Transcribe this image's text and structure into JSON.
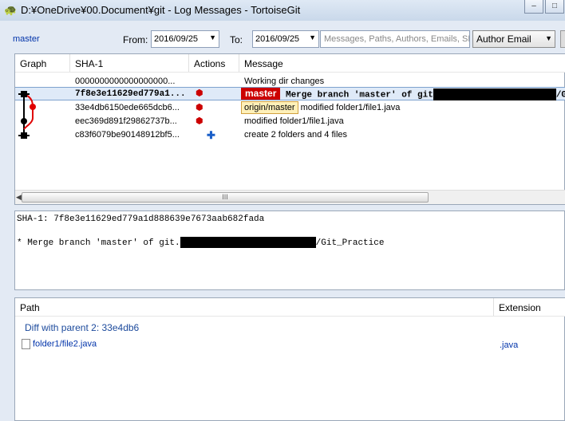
{
  "window": {
    "title": "D:¥OneDrive¥00.Document¥git - Log Messages - TortoiseGit",
    "minimize": "–",
    "maximize": "□"
  },
  "filters": {
    "branch": "master",
    "from_label": "From:",
    "from_date": "2016/09/25",
    "to_label": "To:",
    "to_date": "2016/09/25",
    "search_placeholder": "Messages, Paths, Authors, Emails, SHA",
    "filter_by": "Author Email"
  },
  "log_table": {
    "columns": [
      "Graph",
      "SHA-1",
      "Actions",
      "Message"
    ],
    "rows": [
      {
        "sha": "0000000000000000000...",
        "message": "Working dir changes",
        "icon": null
      },
      {
        "sha": "7f8e3e11629ed779a1...",
        "message_prefix": "Merge branch 'master' of git",
        "message_suffix": "/Git_",
        "ref": "master",
        "icon": "merge-icon",
        "selected": true
      },
      {
        "sha": "33e4db6150ede665dcb6...",
        "message": "modified folder1/file1.java",
        "ref": "origin/master",
        "icon": "modify-icon"
      },
      {
        "sha": "eec369d891f29862737b...",
        "message": "modified folder1/file1.java",
        "icon": "modify-icon"
      },
      {
        "sha": "c83f6079be90148912bf5...",
        "message": "create 2 folders and 4 files",
        "icon": "add-icon"
      }
    ],
    "scroll_grip": "III"
  },
  "detail": {
    "sha_line": "SHA-1: 7f8e3e11629ed779a1d888639e7673aab682fada",
    "msg_prefix": "* Merge branch 'master' of git.",
    "msg_suffix": "/Git_Practice"
  },
  "files": {
    "col_path": "Path",
    "col_extension": "Extension",
    "diff_header": "Diff with parent 2: 33e4db6",
    "items": [
      {
        "path": "folder1/file2.java",
        "ext": ".java"
      }
    ]
  },
  "colors": {
    "accent_red": "#cc0000",
    "ref_yellow": "#fff0b8",
    "link_blue": "#0033aa"
  }
}
